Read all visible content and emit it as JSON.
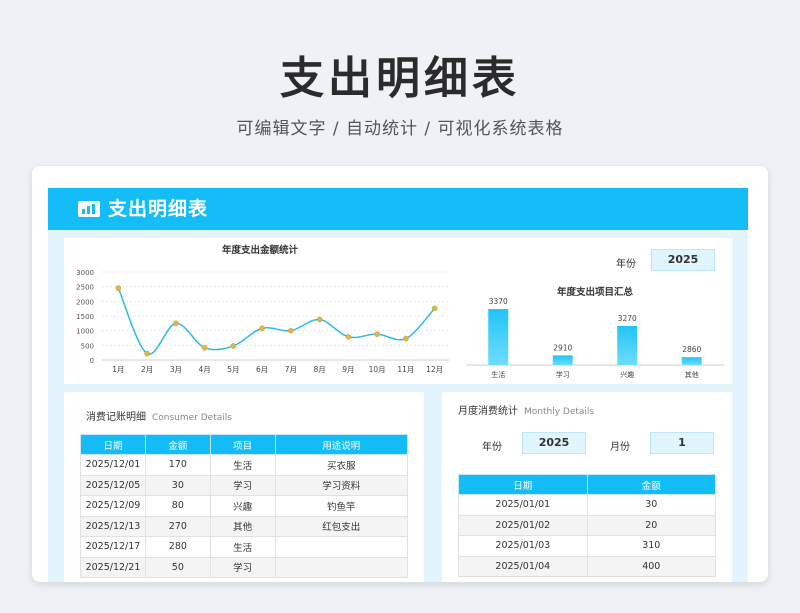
{
  "hero": {
    "title": "支出明细表",
    "subtitle": "可编辑文字 / 自动统计 / 可视化系统表格"
  },
  "sheet": {
    "title": "支出明细表",
    "year_label": "年份",
    "year_value": "2025"
  },
  "colors": {
    "accent": "#14bdf7",
    "light": "#e4f4fd",
    "point": "#e0b54a"
  },
  "chart_data": [
    {
      "type": "line",
      "title": "年度支出金额统计",
      "categories": [
        "1月",
        "2月",
        "3月",
        "4月",
        "5月",
        "6月",
        "7月",
        "8月",
        "9月",
        "10月",
        "11月",
        "12月"
      ],
      "values": [
        2450,
        220,
        1250,
        420,
        480,
        1080,
        1000,
        1380,
        790,
        880,
        730,
        1760
      ],
      "ylim": [
        0,
        3000
      ],
      "yticks": [
        "3000",
        "2500",
        "2000",
        "1500",
        "1000",
        "500",
        "0"
      ],
      "grid": true
    },
    {
      "type": "bar",
      "title": "年度支出项目汇总",
      "categories": [
        "生活",
        "学习",
        "兴趣",
        "其他"
      ],
      "values": [
        3370,
        2910,
        3270,
        2860
      ],
      "labels": [
        "3370",
        "2910",
        "3270",
        "2860"
      ]
    }
  ],
  "consumer": {
    "title": "消费记账明细",
    "title_en": "Consumer Details",
    "headers": [
      "日期",
      "金额",
      "项目",
      "用途说明"
    ],
    "rows": [
      [
        "2025/12/01",
        "170",
        "生活",
        "买衣服"
      ],
      [
        "2025/12/05",
        "30",
        "学习",
        "学习资料"
      ],
      [
        "2025/12/09",
        "80",
        "兴趣",
        "钓鱼竿"
      ],
      [
        "2025/12/13",
        "270",
        "其他",
        "红包支出"
      ],
      [
        "2025/12/17",
        "280",
        "生活",
        ""
      ],
      [
        "2025/12/21",
        "50",
        "学习",
        ""
      ]
    ]
  },
  "monthly": {
    "title": "月度消费统计",
    "title_en": "Monthly Details",
    "year_label": "年份",
    "year_value": "2025",
    "month_label": "月份",
    "month_value": "1",
    "headers": [
      "日期",
      "金额"
    ],
    "rows": [
      [
        "2025/01/01",
        "30"
      ],
      [
        "2025/01/02",
        "20"
      ],
      [
        "2025/01/03",
        "310"
      ],
      [
        "2025/01/04",
        "400"
      ]
    ]
  }
}
